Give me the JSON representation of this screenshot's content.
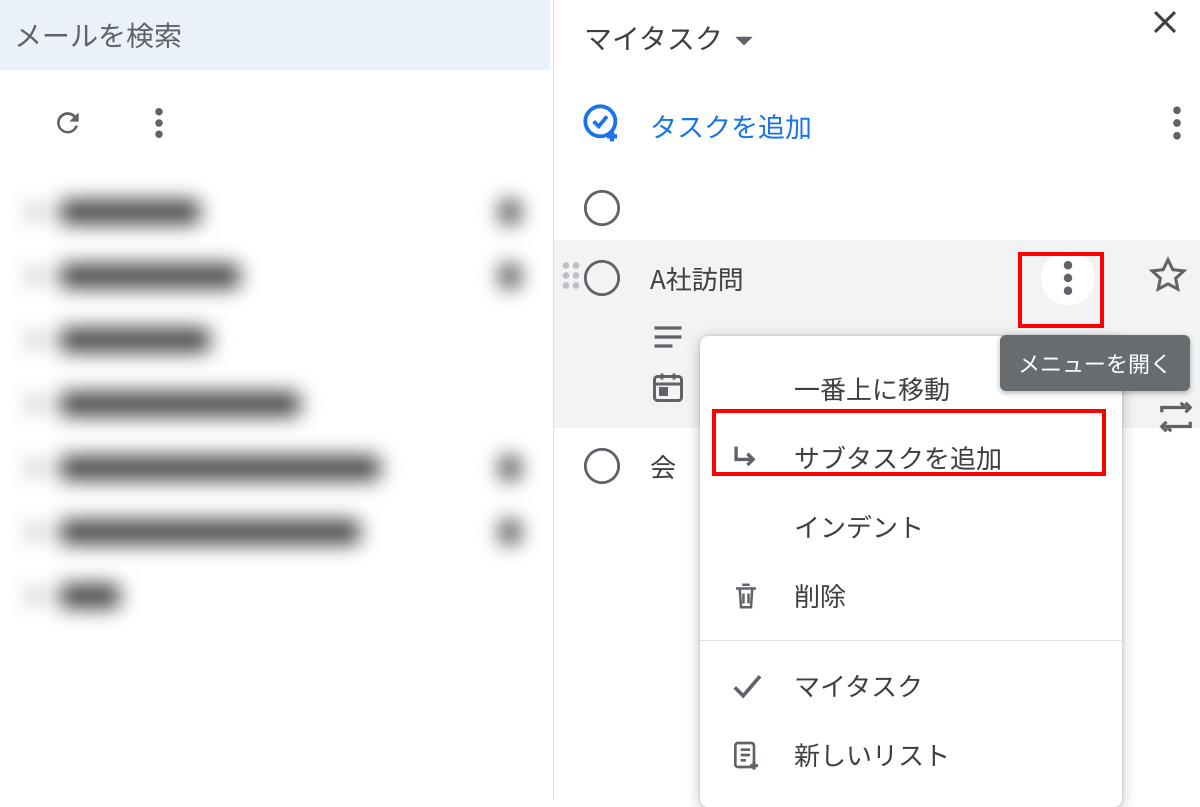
{
  "mail": {
    "search_placeholder": "メールを検索"
  },
  "tasks": {
    "list_name": "マイタスク",
    "add_task_label": "タスクを追加",
    "items": [
      {
        "title": ""
      },
      {
        "title": "A社訪問"
      },
      {
        "title": "会"
      }
    ],
    "tooltip_label": "メニューを開く",
    "menu": {
      "move_top": "一番上に移動",
      "add_subtask": "サブタスクを追加",
      "indent": "インデント",
      "delete": "削除",
      "my_tasks": "マイタスク",
      "new_list": "新しいリスト"
    }
  }
}
